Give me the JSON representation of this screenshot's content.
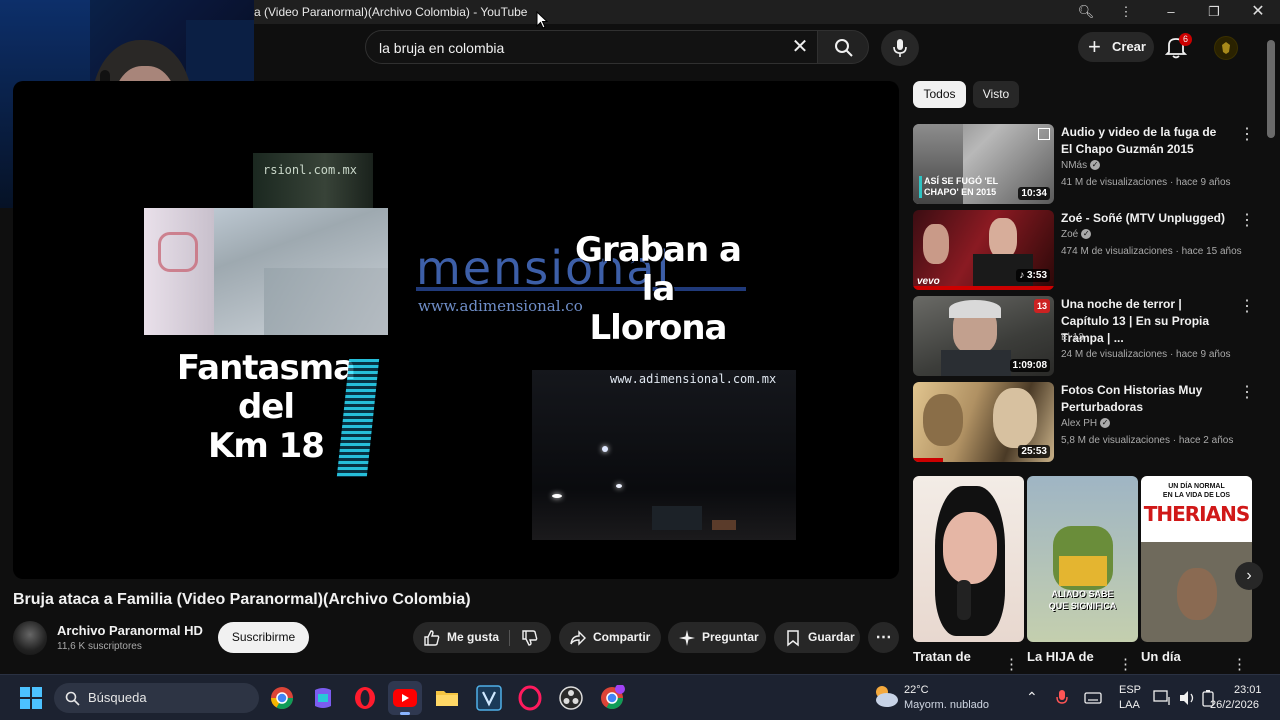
{
  "window": {
    "title": "a (Video Paranormal)(Archivo Colombia) - YouTube"
  },
  "header": {
    "search_value": "la bruja en colombia",
    "create_label": "Crear",
    "notification_count": "6"
  },
  "player": {
    "overlay_left": "Fantasma del\nKm 18",
    "overlay_right": "Graban a la\nLlorona",
    "watermark_top": "rsionl.com.mx",
    "watermark_bottom": "www.adimensional.com.mx",
    "logo_text": "mensional",
    "logo_url": "www.adimensional.co"
  },
  "video": {
    "title": "Bruja ataca a Familia (Video Paranormal)(Archivo Colombia)",
    "channel": "Archivo Paranormal HD",
    "subscribers": "11,6 K suscriptores",
    "subscribe_label": "Suscribirme",
    "like_label": "Me gusta",
    "share_label": "Compartir",
    "ask_label": "Preguntar",
    "save_label": "Guardar"
  },
  "filters": {
    "chips": [
      "Todos",
      "Visto"
    ],
    "selected": "Todos"
  },
  "recommendations": [
    {
      "title": "Audio y video de la fuga de El Chapo Guzmán 2015",
      "channel": "NMás",
      "verified": true,
      "meta": "41 M de visualizaciones · hace 9 años",
      "duration": "10:34",
      "thumb_caption": "ASÍ SE FUGÓ 'EL CHAPO' EN 2015"
    },
    {
      "title": "Zoé - Soñé (MTV Unplugged)",
      "channel": "Zoé",
      "verified": true,
      "meta": "474 M de visualizaciones · hace 15 años",
      "duration": "3:53",
      "thumb_caption": "vevo"
    },
    {
      "title": "Una noche de terror | Capítulo 13 | En su Propia Trampa | ...",
      "channel": "El 13",
      "verified": false,
      "meta": "24 M de visualizaciones · hace 9 años",
      "duration": "1:09:08",
      "thumb_caption": "13"
    },
    {
      "title": "Fotos Con Historias Muy Perturbadoras",
      "channel": "Alex PH",
      "verified": true,
      "meta": "5,8 M de visualizaciones · hace 2 años",
      "duration": "25:53",
      "thumb_caption": ""
    }
  ],
  "shorts": [
    {
      "title": "Tratan de",
      "caption": ""
    },
    {
      "title": "La HIJA de",
      "caption": "ALIADO SABE\nQUE SIGNIFICA"
    },
    {
      "title": "Un día",
      "caption_small": "UN DÍA NORMAL\nEN LA VIDA DE LOS",
      "caption_big": "THERIANS"
    }
  ],
  "taskbar": {
    "search_placeholder": "Búsqueda",
    "weather_temp": "22°C",
    "weather_desc": "Mayorm. nublado",
    "lang_top": "ESP",
    "lang_bottom": "LAA",
    "time": "23:01",
    "date": "26/2/2026"
  },
  "colors": {
    "yt_bg": "#0f0f0f",
    "accent_red": "#cc0000",
    "taskbar": "#1c2230"
  }
}
